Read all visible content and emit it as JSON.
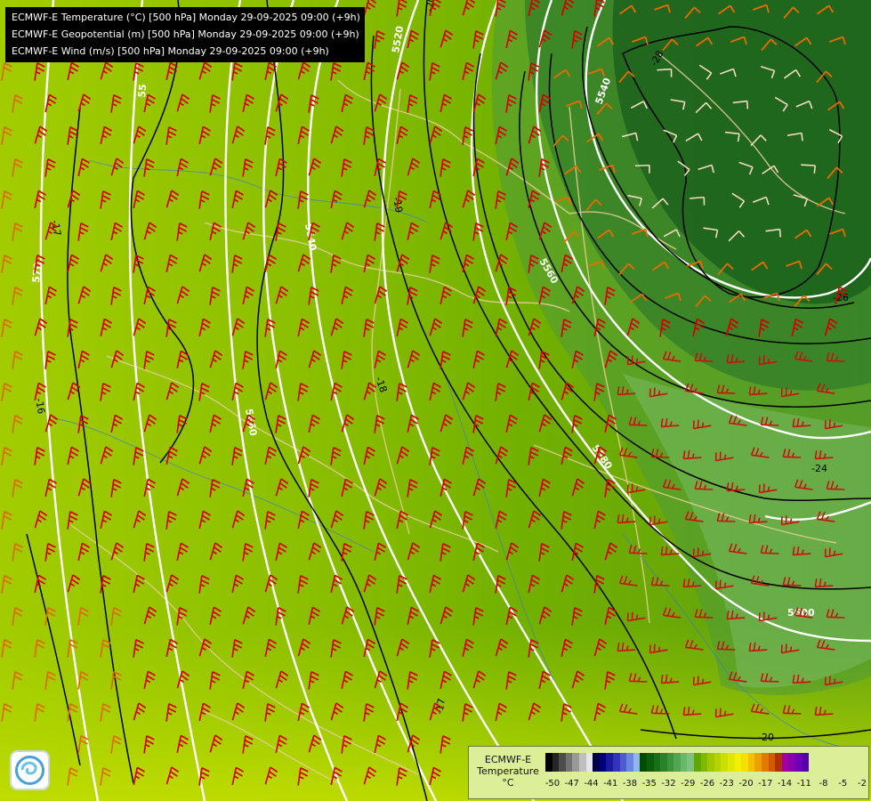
{
  "header": {
    "lines": [
      "ECMWF-E Temperature (°C) [500 hPa] Monday 29-09-2025 09:00 (+9h)",
      "ECMWF-E Geopotential (m) [500 hPa] Monday 29-09-2025 09:00 (+9h)",
      "ECMWF-E Wind (m/s) [500 hPa] Monday 29-09-2025 09:00 (+9h)"
    ]
  },
  "geopotential_labels": [
    "5520",
    "5540",
    "5560",
    "5580",
    "5600",
    "5640",
    "5660",
    "570",
    "55"
  ],
  "temperature_labels": [
    "-28",
    "-26",
    "-24",
    "-20",
    "-19",
    "-18",
    "-17",
    "-17",
    "-16",
    "-20"
  ],
  "legend": {
    "title_lines": [
      "ECMWF-E",
      "Temperature",
      "°C"
    ],
    "colors": [
      "#000000",
      "#262626",
      "#4d4d4d",
      "#737373",
      "#999999",
      "#bfbfbf",
      "#e6e6e6",
      "#00004d",
      "#00007a",
      "#1a1a9e",
      "#3333bb",
      "#4d5cd0",
      "#6a86e0",
      "#8fb4ee",
      "#004d00",
      "#0b5e0b",
      "#177017",
      "#2a822a",
      "#3c943c",
      "#52a652",
      "#6ab86a",
      "#7fc07f",
      "#5fa800",
      "#7fb800",
      "#9fc800",
      "#b3d400",
      "#c9e000",
      "#e0e800",
      "#f0f000",
      "#f7e000",
      "#f5c000",
      "#eda000",
      "#e07b00",
      "#cf5a00",
      "#b33000",
      "#a200a2",
      "#8a00b0",
      "#6f00b8",
      "#5500a8"
    ],
    "ticks": [
      "-50",
      "-47",
      "-44",
      "-41",
      "-38",
      "-35",
      "-32",
      "-29",
      "-26",
      "-23",
      "-20",
      "-17",
      "-14",
      "-11",
      "-8",
      "-5",
      "-2"
    ]
  },
  "logo": {
    "icon": "ecmwf-logo-icon"
  }
}
